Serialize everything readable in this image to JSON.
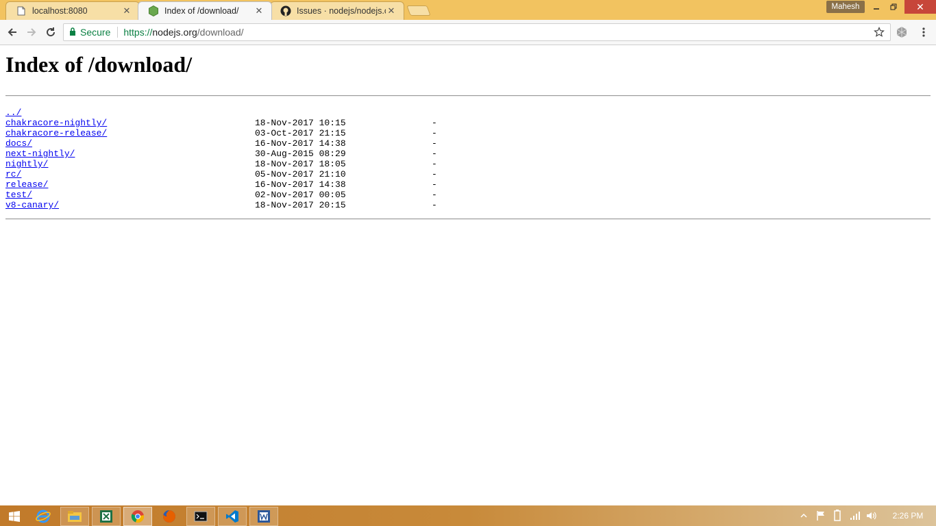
{
  "browser": {
    "tabs": [
      {
        "label": "localhost:8080",
        "icon": "page-icon",
        "active": false
      },
      {
        "label": "Index of /download/",
        "icon": "nodejs-icon",
        "active": true
      },
      {
        "label": "Issues · nodejs/nodejs.org",
        "icon": "github-icon",
        "active": false
      }
    ],
    "profile_name": "Mahesh",
    "secure_label": "Secure",
    "url": {
      "scheme": "https://",
      "host": "nodejs.org",
      "path": "/download/"
    }
  },
  "page": {
    "title": "Index of /download/",
    "parent_link": "../",
    "entries": [
      {
        "name": "chakracore-nightly/",
        "date": "18-Nov-2017 10:15",
        "size": "-"
      },
      {
        "name": "chakracore-release/",
        "date": "03-Oct-2017 21:15",
        "size": "-"
      },
      {
        "name": "docs/",
        "date": "16-Nov-2017 14:38",
        "size": "-"
      },
      {
        "name": "next-nightly/",
        "date": "30-Aug-2015 08:29",
        "size": "-"
      },
      {
        "name": "nightly/",
        "date": "18-Nov-2017 18:05",
        "size": "-"
      },
      {
        "name": "rc/",
        "date": "05-Nov-2017 21:10",
        "size": "-"
      },
      {
        "name": "release/",
        "date": "16-Nov-2017 14:38",
        "size": "-"
      },
      {
        "name": "test/",
        "date": "02-Nov-2017 00:05",
        "size": "-"
      },
      {
        "name": "v8-canary/",
        "date": "18-Nov-2017 20:15",
        "size": "-"
      }
    ]
  },
  "taskbar": {
    "clock": "2:26 PM",
    "apps": [
      "windows-start-icon",
      "internet-explorer-icon",
      "file-explorer-icon",
      "excel-icon",
      "chrome-icon",
      "firefox-icon",
      "cmd-icon",
      "vscode-icon",
      "word-icon"
    ]
  },
  "colors": {
    "titlebar": "#f2c360",
    "link": "#0000ee",
    "secure_green": "#0b8043"
  }
}
